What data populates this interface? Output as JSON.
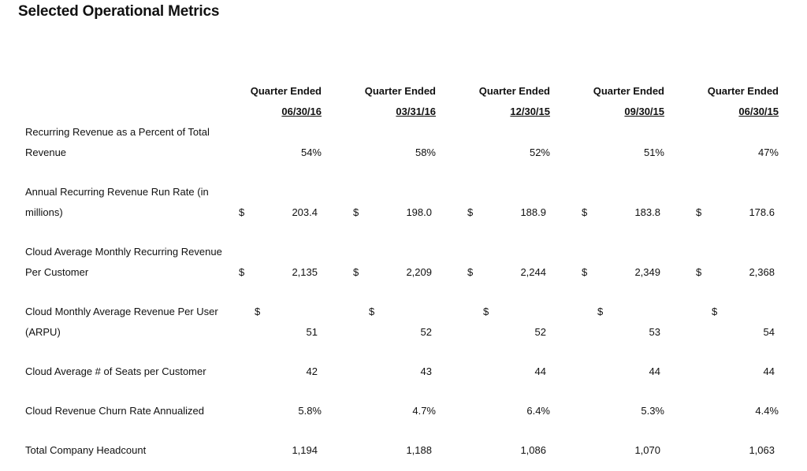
{
  "title": "Selected Operational Metrics",
  "columns": [
    {
      "header": "Quarter Ended",
      "date": "06/30/16"
    },
    {
      "header": "Quarter Ended",
      "date": "03/31/16"
    },
    {
      "header": "Quarter Ended",
      "date": "12/30/15"
    },
    {
      "header": "Quarter Ended",
      "date": "09/30/15"
    },
    {
      "header": "Quarter Ended",
      "date": "06/30/15"
    }
  ],
  "rows": [
    {
      "label_line1": "Recurring Revenue as a Percent of Total",
      "label_line2": "Revenue",
      "currency": "",
      "values": [
        "54%",
        "58%",
        "52%",
        "51%",
        "47%"
      ]
    },
    {
      "label_line1": "Annual Recurring Revenue Run Rate (in",
      "label_line2": "millions)",
      "currency": "$",
      "values": [
        "203.4",
        "198.0",
        "188.9",
        "183.8",
        "178.6"
      ]
    },
    {
      "label_line1": "Cloud Average Monthly Recurring Revenue",
      "label_line2": "Per Customer",
      "currency": "$",
      "values": [
        "2,135",
        "2,209",
        "2,244",
        "2,349",
        "2,368"
      ]
    },
    {
      "label_line1": "Cloud Monthly Average Revenue Per User",
      "label_line2": "(ARPU)",
      "currency": "$",
      "values": [
        "51",
        "52",
        "52",
        "53",
        "54"
      ]
    },
    {
      "label_line1": "Cloud Average # of Seats per Customer",
      "currency": "",
      "values": [
        "42",
        "43",
        "44",
        "44",
        "44"
      ]
    },
    {
      "label_line1": "Cloud Revenue Churn Rate Annualized",
      "currency": "",
      "values": [
        "5.8%",
        "4.7%",
        "6.4%",
        "5.3%",
        "4.4%"
      ]
    },
    {
      "label_line1": "Total Company Headcount",
      "currency": "",
      "values": [
        "1,194",
        "1,188",
        "1,086",
        "1,070",
        "1,063"
      ]
    }
  ]
}
